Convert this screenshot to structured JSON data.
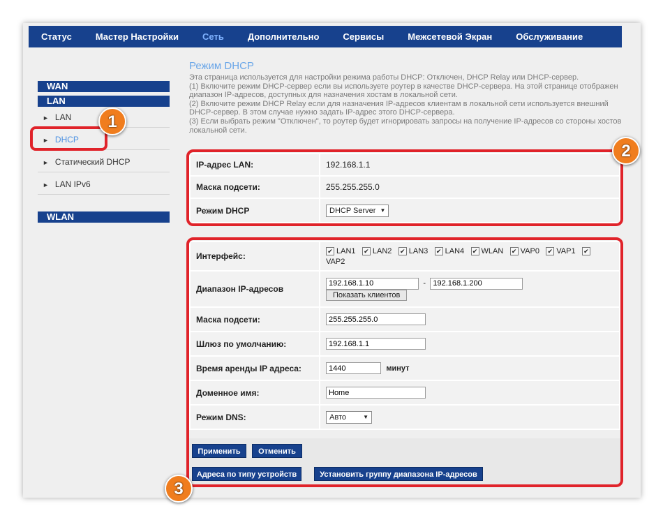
{
  "nav": [
    "Статус",
    "Мастер Настройки",
    "Сеть",
    "Дополнительно",
    "Сервисы",
    "Межсетевой Экран",
    "Обслуживание"
  ],
  "nav_active_index": 2,
  "sidebar": {
    "wan": "WAN",
    "lan": "LAN",
    "items": [
      "LAN",
      "DHCP",
      "Статический DHCP",
      "LAN IPv6"
    ],
    "active_index": 1,
    "wlan": "WLAN"
  },
  "page": {
    "title": "Режим DHCP",
    "description": [
      "Эта страница используется для настройки режима работы DHCP: Отключен, DHCP Relay или DHCP-сервер.",
      "(1) Включите режим DHCP-сервер если вы используете роутер в качестве DHCP-сервера. На этой странице отображен диапазон IP-адресов, доступных для назначения хостам в локальной сети.",
      "(2) Включите режим DHCP Relay если для назначения IP-адресов клиентам в локальной сети используется внешний DHCP-сервер. В этом случае нужно задать IP-адрес этого DHCP-сервера.",
      "(3) Если выбрать режим \"Отключен\", то роутер будет игнорировать запросы на получение IP-адресов со стороны хостов локальной сети."
    ]
  },
  "lan_info": {
    "ip_label": "IP-адрес LAN:",
    "ip_value": "192.168.1.1",
    "mask_label": "Маска подсети:",
    "mask_value": "255.255.255.0",
    "mode_label": "Режим DHCP",
    "mode_value": "DHCP Server"
  },
  "dhcp": {
    "interface_label": "Интерфейс:",
    "interfaces": [
      "LAN1",
      "LAN2",
      "LAN3",
      "LAN4",
      "WLAN",
      "VAP0",
      "VAP1",
      "VAP2"
    ],
    "range_label": "Диапазон IP-адресов",
    "range_start": "192.168.1.10",
    "range_sep": "-",
    "range_end": "192.168.1.200",
    "show_clients": "Показать клиентов",
    "mask_label": "Маска подсети:",
    "mask_value": "255.255.255.0",
    "gateway_label": "Шлюз по умолчанию:",
    "gateway_value": "192.168.1.1",
    "lease_label": "Время аренды IP адреса:",
    "lease_value": "1440",
    "lease_unit": "минут",
    "domain_label": "Доменное имя:",
    "domain_value": "Home",
    "dns_label": "Режим DNS:",
    "dns_value": "Авто"
  },
  "buttons": {
    "apply": "Применить",
    "cancel": "Отменить",
    "device_addr": "Адреса по типу устройств",
    "set_range_group": "Установить группу диапазона IP-адресов"
  },
  "badges": [
    "1",
    "2",
    "3"
  ],
  "colors": {
    "nav_bg": "#17418d",
    "active": "#4a90e2",
    "highlight": "#e0232a",
    "badge": "#f07d1e"
  }
}
